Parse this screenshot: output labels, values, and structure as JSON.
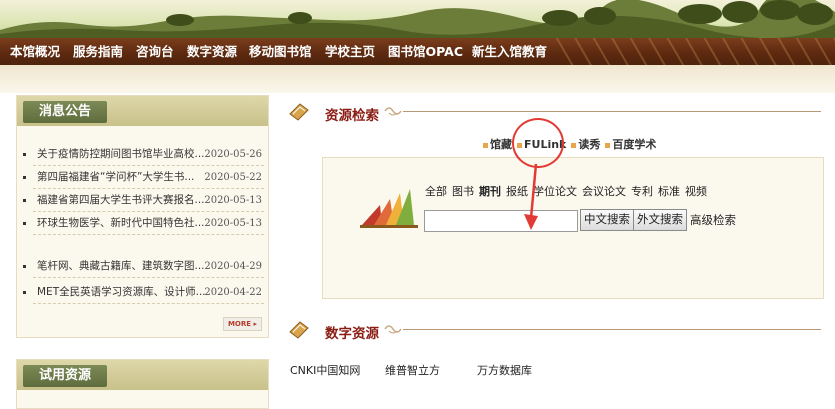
{
  "nav": {
    "items": [
      "本馆概况",
      "服务指南",
      "咨询台",
      "数字资源",
      "移动图书馆",
      "学校主页",
      "图书馆OPAC",
      "新生入馆教育"
    ]
  },
  "news": {
    "title": "消息公告",
    "items": [
      {
        "title": "关于疫情防控期间图书馆毕业高校...",
        "date": "2020-05-26"
      },
      {
        "title": "第四届福建省“学问杯”大学生书...",
        "date": "2020-05-22"
      },
      {
        "title": "福建省第四届大学生书评大赛报名...",
        "date": "2020-05-13"
      },
      {
        "title": "环球生物医学、新时代中国特色社...",
        "date": "2020-05-13"
      },
      {
        "title": "笔杆网、典藏古籍库、建筑数字图...",
        "date": "2020-04-29"
      },
      {
        "title": "MET全民英语学习资源库、设计师...",
        "date": "2020-04-22"
      }
    ],
    "more": "MORE ▸"
  },
  "trial": {
    "title": "试用资源"
  },
  "search_section": {
    "title": "资源检索",
    "sources": [
      "馆藏",
      "FULink",
      "读秀",
      "百度学术"
    ],
    "types": [
      "全部",
      "图书",
      "期刊",
      "报纸",
      "学位论文",
      "会议论文",
      "专利",
      "标准",
      "视频"
    ],
    "active_type": "期刊",
    "input_value": "",
    "btn_cn": "中文搜索",
    "btn_foreign": "外文搜索",
    "advanced": "高级检索"
  },
  "digital_section": {
    "title": "数字资源",
    "databases": [
      "CNKI中国知网",
      "维普智立方",
      "万方数据库"
    ]
  },
  "colors": {
    "nav_bg": "#5e2a10",
    "accent": "#8a1c13",
    "annotation": "#e23a34"
  }
}
